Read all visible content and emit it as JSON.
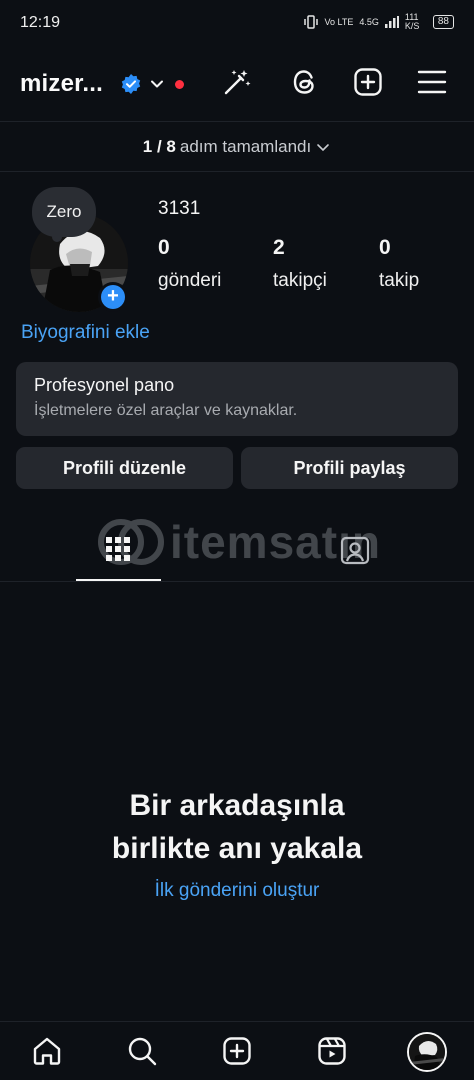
{
  "status_bar": {
    "time": "12:19",
    "network_a": "Vo LTE",
    "network_b": "4.5G",
    "speed": "111 K/S",
    "battery": "88"
  },
  "header": {
    "username": "mizer...",
    "icons": [
      "verified-badge-icon",
      "chevron-down-icon",
      "notification-dot",
      "magic-wand-icon",
      "threads-icon",
      "create-icon",
      "menu-icon"
    ]
  },
  "steps": {
    "count": "1 / 8",
    "text": "adım tamamlandı"
  },
  "profile": {
    "note": "Zero",
    "display_name": "3131",
    "stats": [
      {
        "value": "0",
        "label": "gönderi"
      },
      {
        "value": "2",
        "label": "takipçi"
      },
      {
        "value": "0",
        "label": "takip"
      }
    ],
    "bio_link": "Biyografini ekle"
  },
  "pro_dashboard": {
    "title": "Profesyonel pano",
    "subtitle": "İşletmelere özel araçlar ve kaynaklar."
  },
  "buttons": {
    "edit_profile": "Profili düzenle",
    "share_profile": "Profili paylaş"
  },
  "watermark": "itemsatın",
  "tabs": [
    "grid-icon",
    "tagged-icon"
  ],
  "empty_state": {
    "line1": "Bir arkadaşınla",
    "line2": "birlikte anı yakala",
    "link": "İlk gönderini oluştur"
  },
  "bottom_nav": [
    "home-icon",
    "search-icon",
    "create-icon",
    "reels-icon",
    "profile-avatar"
  ],
  "colors": {
    "background": "#0c0f14",
    "card": "#25282e",
    "accent_blue": "#4aa3f5",
    "verified_blue": "#2c8ef8",
    "notification_red": "#ff3040"
  }
}
